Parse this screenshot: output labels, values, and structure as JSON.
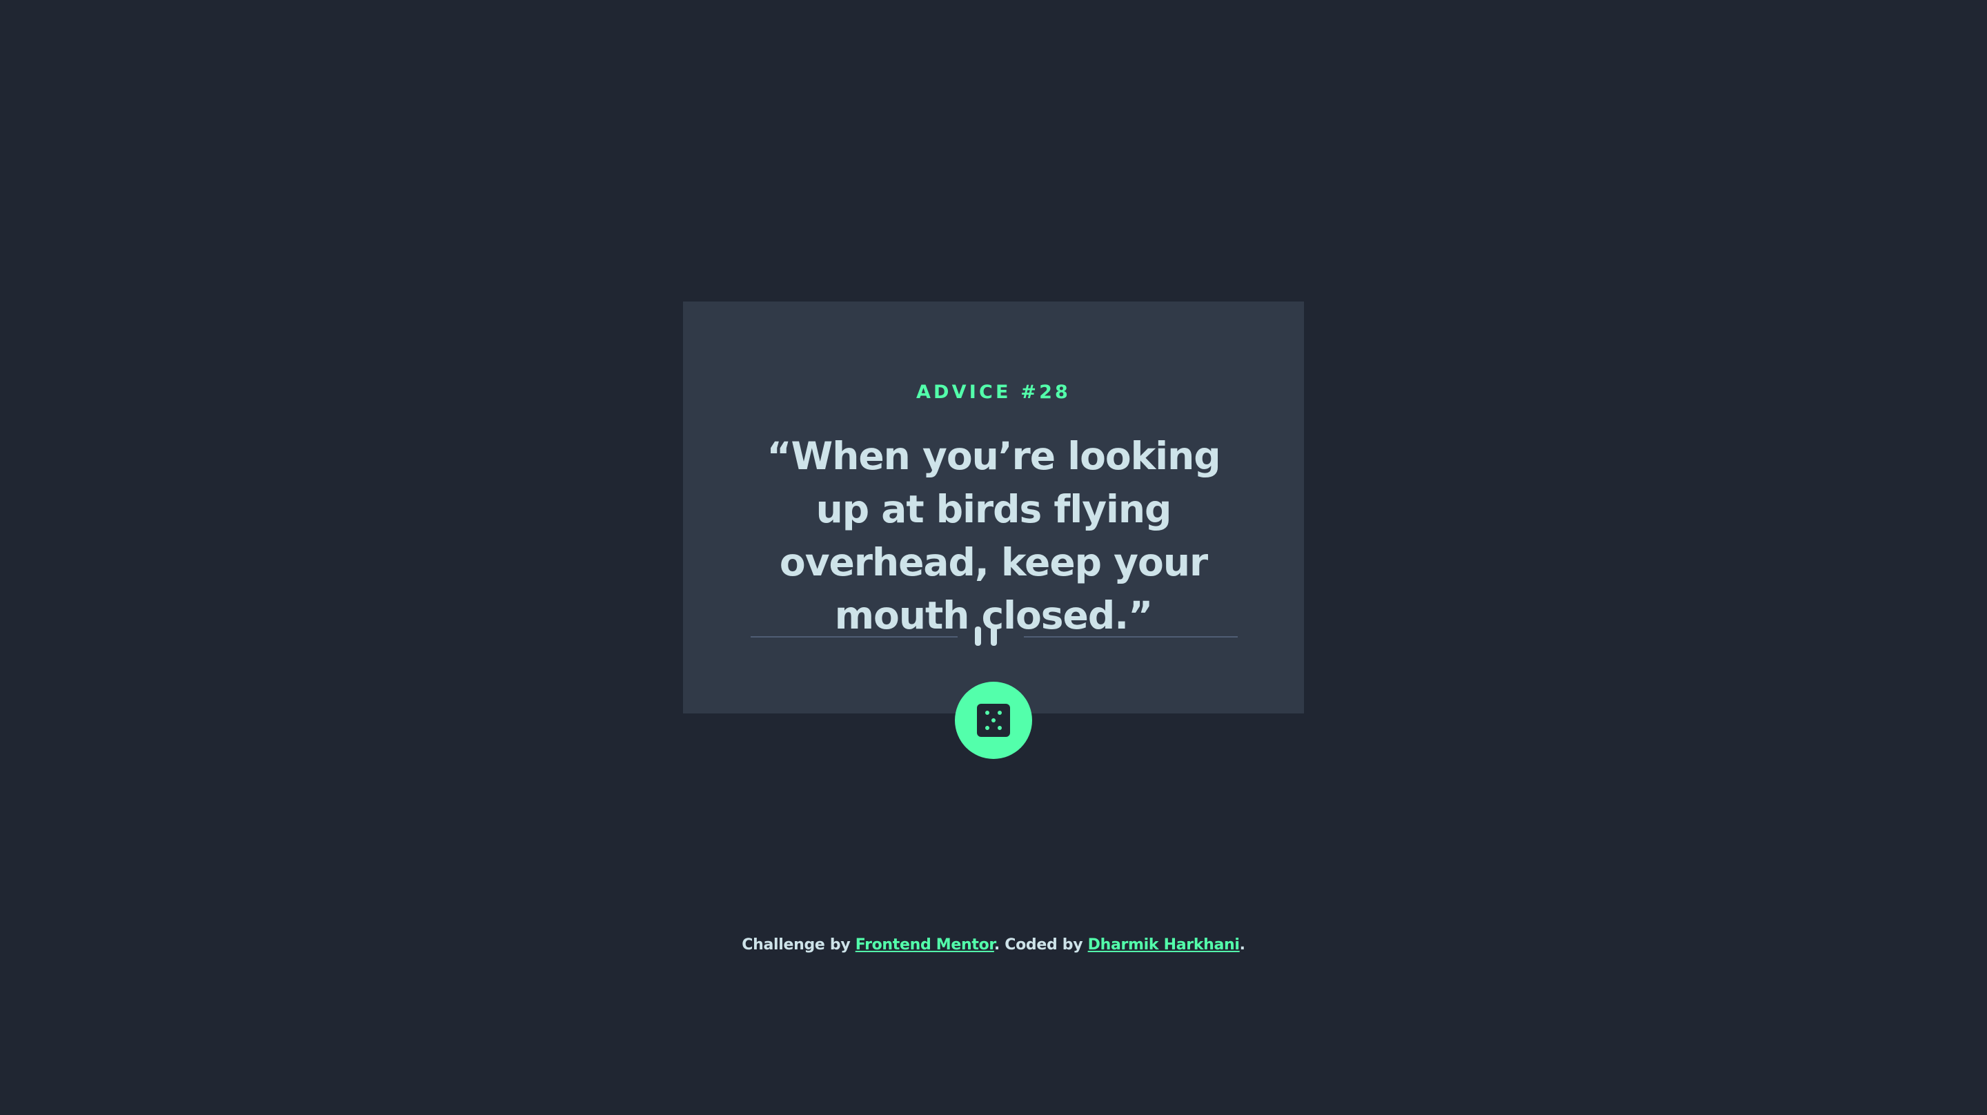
{
  "card": {
    "advice_label": "ADVICE #28",
    "quote": "“When you’re looking up at birds flying overhead, keep your mouth closed.”"
  },
  "divider": {
    "icon": "pause-icon"
  },
  "dice_button": {
    "icon": "dice-icon"
  },
  "attribution": {
    "prefix": "Challenge by ",
    "challenge_link": "Frontend Mentor",
    "middle": ". Coded by ",
    "author_link": "Dharmik Harkhani",
    "suffix": "."
  },
  "colors": {
    "background": "#202632",
    "card": "#313a48",
    "accent": "#53ffab",
    "text": "#cee3e9",
    "divider": "#4f5d74"
  }
}
